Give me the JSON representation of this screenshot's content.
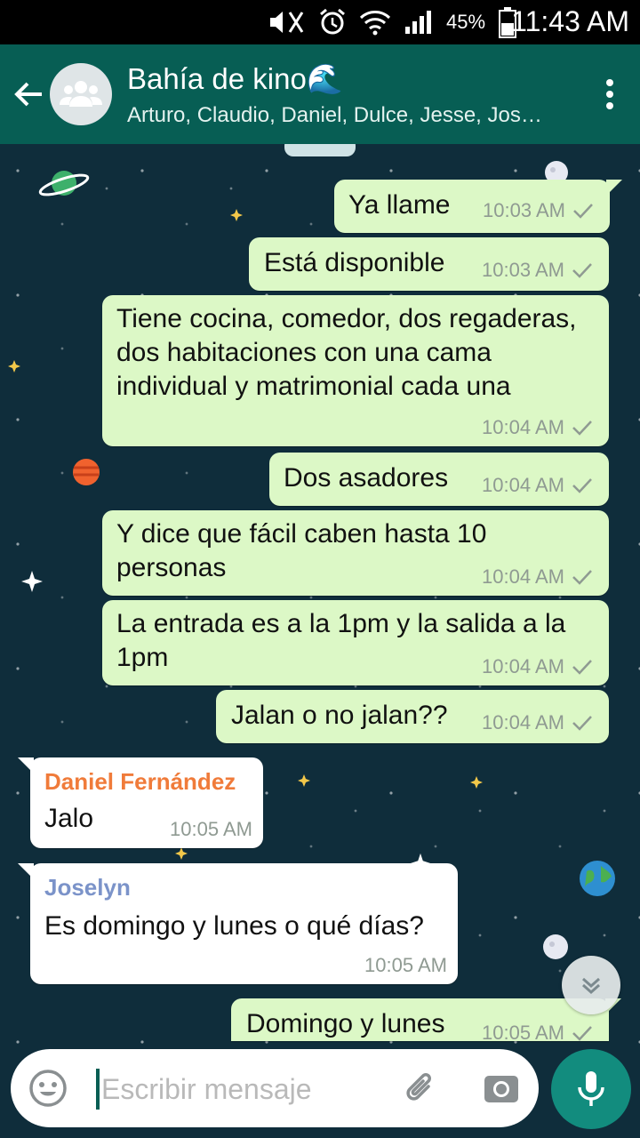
{
  "status_bar": {
    "battery_percent": "45%",
    "time": "11:43 AM"
  },
  "header": {
    "title": "Bahía de kino🌊",
    "subtitle": "Arturo, Claudio, Daniel, Dulce, Jesse, Jos…"
  },
  "messages": [
    {
      "dir": "out",
      "text": "Ya llame",
      "time": "10:03 AM"
    },
    {
      "dir": "out",
      "text": "Está disponible",
      "time": "10:03 AM"
    },
    {
      "dir": "out",
      "text": "Tiene cocina, comedor, dos regaderas, dos habitaciones con una cama individual y matrimonial cada una",
      "time": "10:04 AM"
    },
    {
      "dir": "out",
      "text": "Dos asadores",
      "time": "10:04 AM"
    },
    {
      "dir": "out",
      "text": "Y dice que fácil caben hasta 10 personas",
      "time": "10:04 AM"
    },
    {
      "dir": "out",
      "text": "La entrada es a la 1pm y la salida a la 1pm",
      "time": "10:04 AM"
    },
    {
      "dir": "out",
      "text": "Jalan o no jalan??",
      "time": "10:04 AM"
    },
    {
      "dir": "in",
      "sender": "Daniel Fernández",
      "text": "Jalo",
      "time": "10:05 AM"
    },
    {
      "dir": "in",
      "sender": "Joselyn",
      "text": "Es domingo y lunes o qué días?",
      "time": "10:05 AM"
    },
    {
      "dir": "out",
      "text": "Domingo y lunes",
      "time": "10:05 AM"
    }
  ],
  "composer": {
    "placeholder": "Escribir mensaje"
  },
  "icons": {
    "back": "arrow-left-icon",
    "avatar": "group-avatar-icon",
    "menu": "more-vert-icon",
    "emoji": "emoji-icon",
    "attach": "paperclip-icon",
    "camera": "camera-icon",
    "mic": "microphone-icon",
    "scroll": "double-chevron-down-icon",
    "read_tick": "check-icon"
  },
  "colors": {
    "header": "#075e54",
    "outgoing_bubble": "#dcf8c6",
    "incoming_bubble": "#ffffff",
    "sender_daniel": "#f07b3a",
    "sender_joselyn": "#7b93c9",
    "mic_button": "#128c7e"
  }
}
